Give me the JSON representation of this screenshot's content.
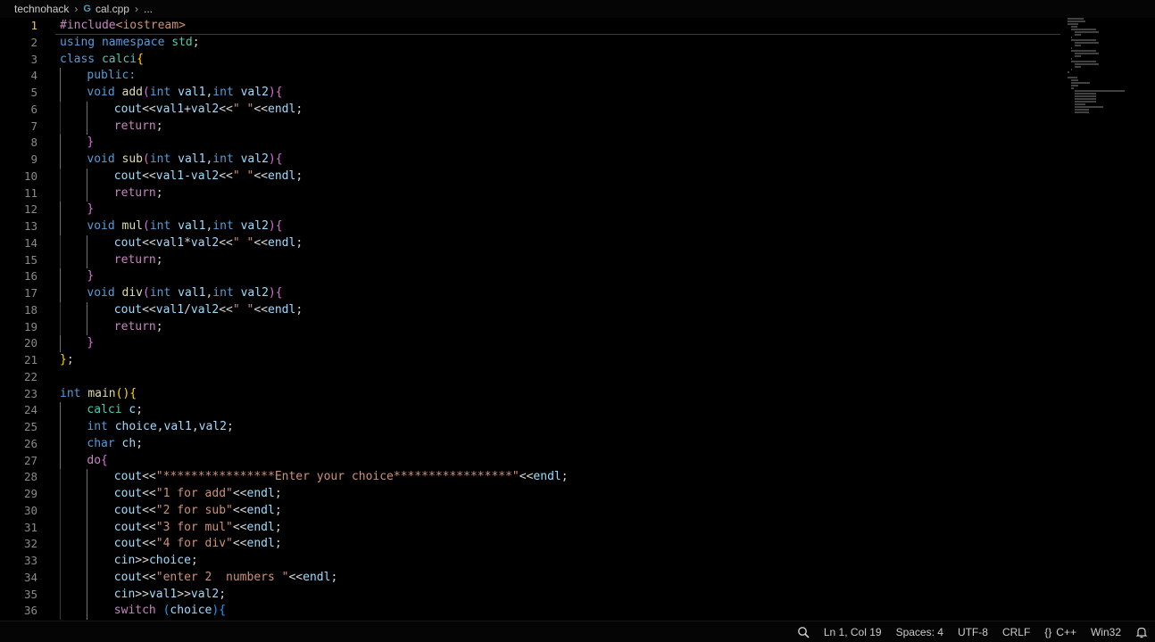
{
  "breadcrumb": {
    "folder": "technohack",
    "file_icon": "G",
    "file": "cal.cpp",
    "more": "..."
  },
  "editor": {
    "current_line": 1,
    "lines": [
      {
        "n": "1",
        "i": 0,
        "t": [
          [
            "t-pp",
            "#include"
          ],
          [
            "t-str",
            "<iostream>"
          ]
        ]
      },
      {
        "n": "2",
        "i": 0,
        "t": [
          [
            "t-kw",
            "using"
          ],
          [
            "t-plain",
            " "
          ],
          [
            "t-kw",
            "namespace"
          ],
          [
            "t-plain",
            " "
          ],
          [
            "t-type",
            "std"
          ],
          [
            "t-plain",
            ";"
          ]
        ]
      },
      {
        "n": "3",
        "i": 0,
        "t": [
          [
            "t-kw",
            "class"
          ],
          [
            "t-plain",
            " "
          ],
          [
            "t-type",
            "calci"
          ],
          [
            "t-p1",
            "{"
          ]
        ]
      },
      {
        "n": "4",
        "i": 1,
        "t": [
          [
            "t-kw",
            "public:"
          ]
        ]
      },
      {
        "n": "5",
        "i": 1,
        "t": [
          [
            "t-kw",
            "void"
          ],
          [
            "t-plain",
            " "
          ],
          [
            "t-fn",
            "add"
          ],
          [
            "t-p2",
            "("
          ],
          [
            "t-kw",
            "int"
          ],
          [
            "t-plain",
            " "
          ],
          [
            "t-var",
            "val1"
          ],
          [
            "t-plain",
            ","
          ],
          [
            "t-kw",
            "int"
          ],
          [
            "t-plain",
            " "
          ],
          [
            "t-var",
            "val2"
          ],
          [
            "t-p2",
            ")"
          ],
          [
            "t-p2",
            "{"
          ]
        ]
      },
      {
        "n": "6",
        "i": 2,
        "t": [
          [
            "t-var",
            "cout"
          ],
          [
            "t-plain",
            "<<"
          ],
          [
            "t-var",
            "val1"
          ],
          [
            "t-plain",
            "+"
          ],
          [
            "t-var",
            "val2"
          ],
          [
            "t-plain",
            "<<"
          ],
          [
            "t-str",
            "\" \""
          ],
          [
            "t-plain",
            "<<"
          ],
          [
            "t-var",
            "endl"
          ],
          [
            "t-plain",
            ";"
          ]
        ]
      },
      {
        "n": "7",
        "i": 2,
        "t": [
          [
            "t-ctl",
            "return"
          ],
          [
            "t-plain",
            ";"
          ]
        ]
      },
      {
        "n": "8",
        "i": 1,
        "t": [
          [
            "t-p2",
            "}"
          ]
        ]
      },
      {
        "n": "9",
        "i": 1,
        "t": [
          [
            "t-kw",
            "void"
          ],
          [
            "t-plain",
            " "
          ],
          [
            "t-fn",
            "sub"
          ],
          [
            "t-p2",
            "("
          ],
          [
            "t-kw",
            "int"
          ],
          [
            "t-plain",
            " "
          ],
          [
            "t-var",
            "val1"
          ],
          [
            "t-plain",
            ","
          ],
          [
            "t-kw",
            "int"
          ],
          [
            "t-plain",
            " "
          ],
          [
            "t-var",
            "val2"
          ],
          [
            "t-p2",
            ")"
          ],
          [
            "t-p2",
            "{"
          ]
        ]
      },
      {
        "n": "10",
        "i": 2,
        "t": [
          [
            "t-var",
            "cout"
          ],
          [
            "t-plain",
            "<<"
          ],
          [
            "t-var",
            "val1"
          ],
          [
            "t-plain",
            "-"
          ],
          [
            "t-var",
            "val2"
          ],
          [
            "t-plain",
            "<<"
          ],
          [
            "t-str",
            "\" \""
          ],
          [
            "t-plain",
            "<<"
          ],
          [
            "t-var",
            "endl"
          ],
          [
            "t-plain",
            ";"
          ]
        ]
      },
      {
        "n": "11",
        "i": 2,
        "t": [
          [
            "t-ctl",
            "return"
          ],
          [
            "t-plain",
            ";"
          ]
        ]
      },
      {
        "n": "12",
        "i": 1,
        "t": [
          [
            "t-p2",
            "}"
          ]
        ]
      },
      {
        "n": "13",
        "i": 1,
        "t": [
          [
            "t-kw",
            "void"
          ],
          [
            "t-plain",
            " "
          ],
          [
            "t-fn",
            "mul"
          ],
          [
            "t-p2",
            "("
          ],
          [
            "t-kw",
            "int"
          ],
          [
            "t-plain",
            " "
          ],
          [
            "t-var",
            "val1"
          ],
          [
            "t-plain",
            ","
          ],
          [
            "t-kw",
            "int"
          ],
          [
            "t-plain",
            " "
          ],
          [
            "t-var",
            "val2"
          ],
          [
            "t-p2",
            ")"
          ],
          [
            "t-p2",
            "{"
          ]
        ]
      },
      {
        "n": "14",
        "i": 2,
        "t": [
          [
            "t-var",
            "cout"
          ],
          [
            "t-plain",
            "<<"
          ],
          [
            "t-var",
            "val1"
          ],
          [
            "t-plain",
            "*"
          ],
          [
            "t-var",
            "val2"
          ],
          [
            "t-plain",
            "<<"
          ],
          [
            "t-str",
            "\" \""
          ],
          [
            "t-plain",
            "<<"
          ],
          [
            "t-var",
            "endl"
          ],
          [
            "t-plain",
            ";"
          ]
        ]
      },
      {
        "n": "15",
        "i": 2,
        "t": [
          [
            "t-ctl",
            "return"
          ],
          [
            "t-plain",
            ";"
          ]
        ]
      },
      {
        "n": "16",
        "i": 1,
        "t": [
          [
            "t-p2",
            "}"
          ]
        ]
      },
      {
        "n": "17",
        "i": 1,
        "t": [
          [
            "t-kw",
            "void"
          ],
          [
            "t-plain",
            " "
          ],
          [
            "t-fn",
            "div"
          ],
          [
            "t-p2",
            "("
          ],
          [
            "t-kw",
            "int"
          ],
          [
            "t-plain",
            " "
          ],
          [
            "t-var",
            "val1"
          ],
          [
            "t-plain",
            ","
          ],
          [
            "t-kw",
            "int"
          ],
          [
            "t-plain",
            " "
          ],
          [
            "t-var",
            "val2"
          ],
          [
            "t-p2",
            ")"
          ],
          [
            "t-p2",
            "{"
          ]
        ]
      },
      {
        "n": "18",
        "i": 2,
        "t": [
          [
            "t-var",
            "cout"
          ],
          [
            "t-plain",
            "<<"
          ],
          [
            "t-var",
            "val1"
          ],
          [
            "t-plain",
            "/"
          ],
          [
            "t-var",
            "val2"
          ],
          [
            "t-plain",
            "<<"
          ],
          [
            "t-str",
            "\" \""
          ],
          [
            "t-plain",
            "<<"
          ],
          [
            "t-var",
            "endl"
          ],
          [
            "t-plain",
            ";"
          ]
        ]
      },
      {
        "n": "19",
        "i": 2,
        "t": [
          [
            "t-ctl",
            "return"
          ],
          [
            "t-plain",
            ";"
          ]
        ]
      },
      {
        "n": "20",
        "i": 1,
        "t": [
          [
            "t-p2",
            "}"
          ]
        ]
      },
      {
        "n": "21",
        "i": 0,
        "t": [
          [
            "t-p1",
            "}"
          ],
          [
            "t-plain",
            ";"
          ]
        ]
      },
      {
        "n": "22",
        "i": 0,
        "t": []
      },
      {
        "n": "23",
        "i": 0,
        "t": [
          [
            "t-kw",
            "int"
          ],
          [
            "t-plain",
            " "
          ],
          [
            "t-fn",
            "main"
          ],
          [
            "t-p1",
            "()"
          ],
          [
            "t-p1",
            "{"
          ]
        ]
      },
      {
        "n": "24",
        "i": 1,
        "t": [
          [
            "t-type",
            "calci"
          ],
          [
            "t-plain",
            " "
          ],
          [
            "t-var",
            "c"
          ],
          [
            "t-plain",
            ";"
          ]
        ]
      },
      {
        "n": "25",
        "i": 1,
        "t": [
          [
            "t-kw",
            "int"
          ],
          [
            "t-plain",
            " "
          ],
          [
            "t-var",
            "choice"
          ],
          [
            "t-plain",
            ","
          ],
          [
            "t-var",
            "val1"
          ],
          [
            "t-plain",
            ","
          ],
          [
            "t-var",
            "val2"
          ],
          [
            "t-plain",
            ";"
          ]
        ]
      },
      {
        "n": "26",
        "i": 1,
        "t": [
          [
            "t-kw",
            "char"
          ],
          [
            "t-plain",
            " "
          ],
          [
            "t-var",
            "ch"
          ],
          [
            "t-plain",
            ";"
          ]
        ]
      },
      {
        "n": "27",
        "i": 1,
        "t": [
          [
            "t-ctl",
            "do"
          ],
          [
            "t-p2",
            "{"
          ]
        ]
      },
      {
        "n": "28",
        "i": 2,
        "t": [
          [
            "t-var",
            "cout"
          ],
          [
            "t-plain",
            "<<"
          ],
          [
            "t-str",
            "\"****************Enter your choice*****************\""
          ],
          [
            "t-plain",
            "<<"
          ],
          [
            "t-var",
            "endl"
          ],
          [
            "t-plain",
            ";"
          ]
        ]
      },
      {
        "n": "29",
        "i": 2,
        "t": [
          [
            "t-var",
            "cout"
          ],
          [
            "t-plain",
            "<<"
          ],
          [
            "t-str",
            "\"1 for add\""
          ],
          [
            "t-plain",
            "<<"
          ],
          [
            "t-var",
            "endl"
          ],
          [
            "t-plain",
            ";"
          ]
        ]
      },
      {
        "n": "30",
        "i": 2,
        "t": [
          [
            "t-var",
            "cout"
          ],
          [
            "t-plain",
            "<<"
          ],
          [
            "t-str",
            "\"2 for sub\""
          ],
          [
            "t-plain",
            "<<"
          ],
          [
            "t-var",
            "endl"
          ],
          [
            "t-plain",
            ";"
          ]
        ]
      },
      {
        "n": "31",
        "i": 2,
        "t": [
          [
            "t-var",
            "cout"
          ],
          [
            "t-plain",
            "<<"
          ],
          [
            "t-str",
            "\"3 for mul\""
          ],
          [
            "t-plain",
            "<<"
          ],
          [
            "t-var",
            "endl"
          ],
          [
            "t-plain",
            ";"
          ]
        ]
      },
      {
        "n": "32",
        "i": 2,
        "t": [
          [
            "t-var",
            "cout"
          ],
          [
            "t-plain",
            "<<"
          ],
          [
            "t-str",
            "\"4 for div\""
          ],
          [
            "t-plain",
            "<<"
          ],
          [
            "t-var",
            "endl"
          ],
          [
            "t-plain",
            ";"
          ]
        ]
      },
      {
        "n": "33",
        "i": 2,
        "t": [
          [
            "t-var",
            "cin"
          ],
          [
            "t-plain",
            ">>"
          ],
          [
            "t-var",
            "choice"
          ],
          [
            "t-plain",
            ";"
          ]
        ]
      },
      {
        "n": "34",
        "i": 2,
        "t": [
          [
            "t-var",
            "cout"
          ],
          [
            "t-plain",
            "<<"
          ],
          [
            "t-str",
            "\"enter 2  numbers \""
          ],
          [
            "t-plain",
            "<<"
          ],
          [
            "t-var",
            "endl"
          ],
          [
            "t-plain",
            ";"
          ]
        ]
      },
      {
        "n": "35",
        "i": 2,
        "t": [
          [
            "t-var",
            "cin"
          ],
          [
            "t-plain",
            ">>"
          ],
          [
            "t-var",
            "val1"
          ],
          [
            "t-plain",
            ">>"
          ],
          [
            "t-var",
            "val2"
          ],
          [
            "t-plain",
            ";"
          ]
        ]
      },
      {
        "n": "36",
        "i": 2,
        "t": [
          [
            "t-ctl",
            "switch"
          ],
          [
            "t-plain",
            " "
          ],
          [
            "t-p3",
            "("
          ],
          [
            "t-var",
            "choice"
          ],
          [
            "t-p3",
            ")"
          ],
          [
            "t-p3",
            "{"
          ]
        ]
      }
    ]
  },
  "statusbar": {
    "zoom_icon": "zoom-icon",
    "position": "Ln 1, Col 19",
    "spaces": "Spaces: 4",
    "encoding": "UTF-8",
    "eol": "CRLF",
    "language_braces": "{}",
    "language": "C++",
    "platform": "Win32",
    "bell_icon": "bell-icon"
  }
}
